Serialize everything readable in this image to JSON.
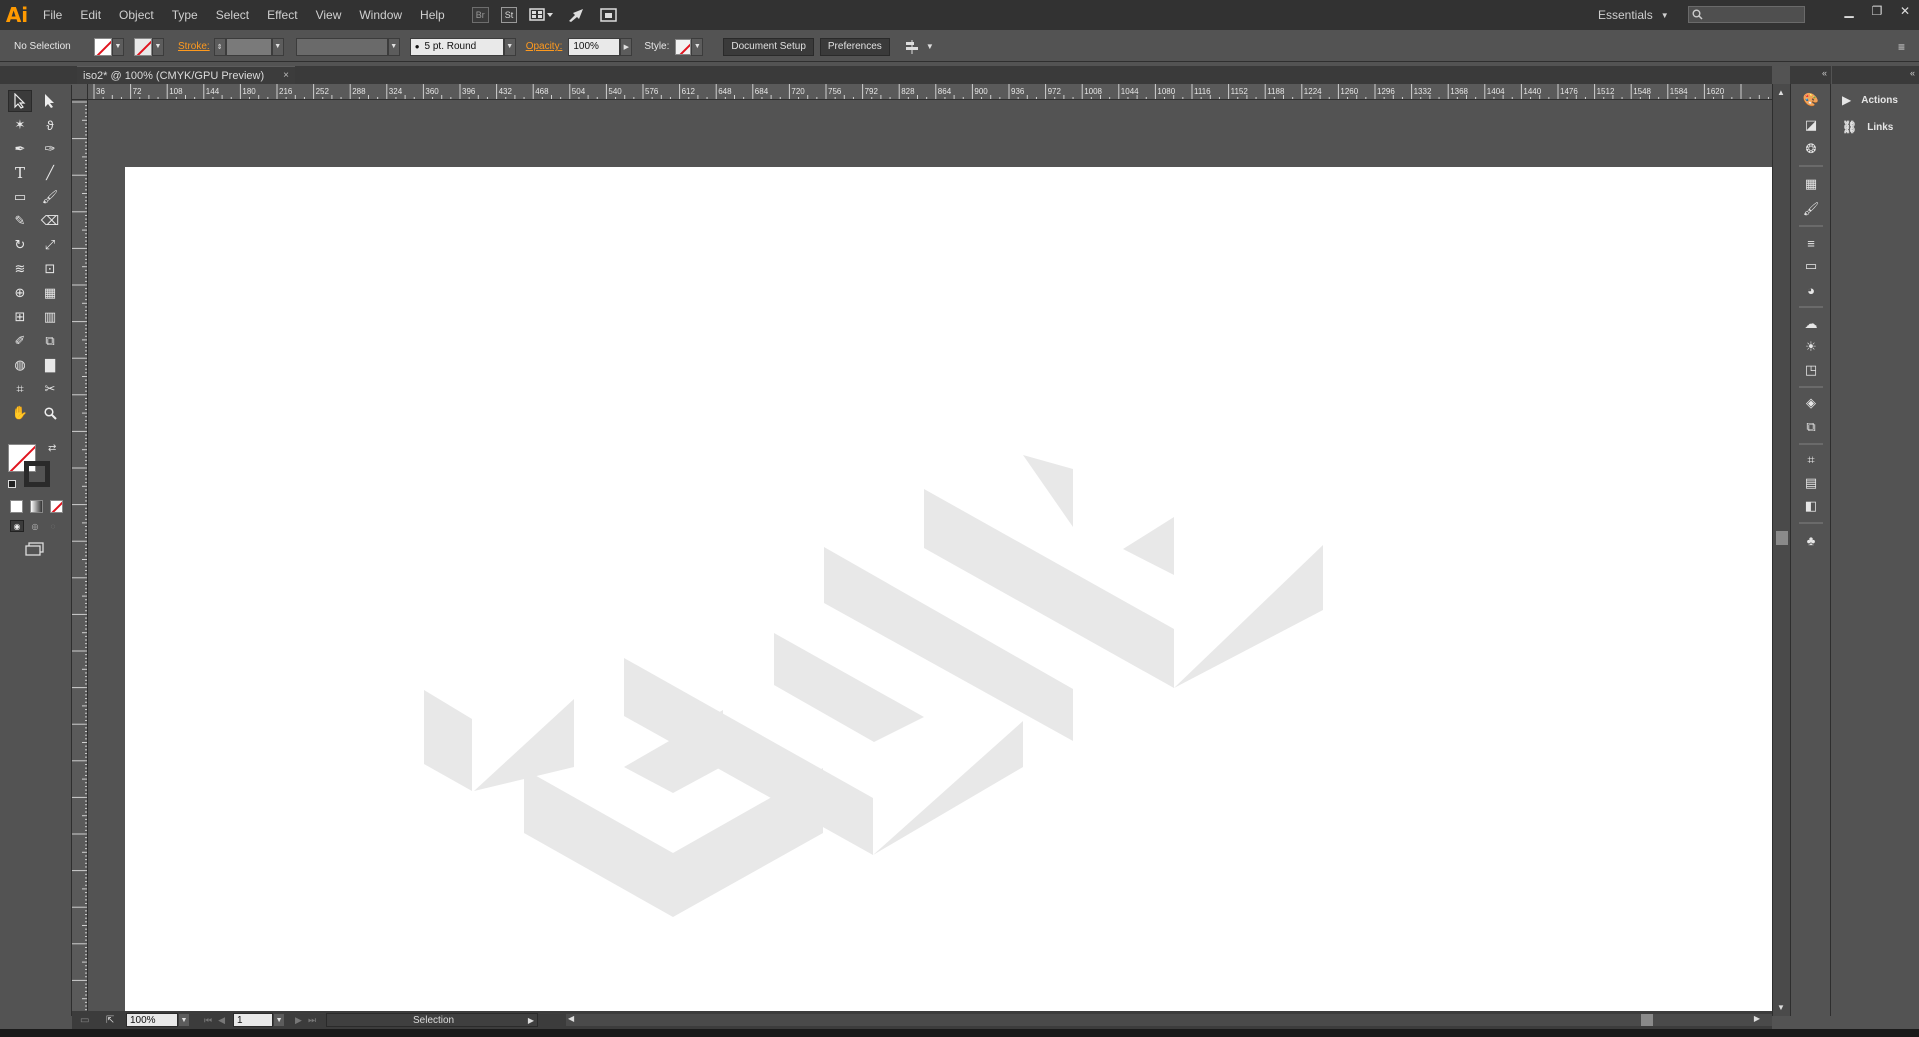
{
  "menubar": {
    "logo": "Ai",
    "items": [
      "File",
      "Edit",
      "Object",
      "Type",
      "Select",
      "Effect",
      "View",
      "Window",
      "Help"
    ],
    "bridge_label": "Br",
    "stock_label": "St",
    "workspace": "Essentials"
  },
  "control": {
    "selection": "No Selection",
    "stroke_label": "Stroke:",
    "brush": "5 pt. Round",
    "opacity_label": "Opacity:",
    "opacity": "100%",
    "style_label": "Style:",
    "doc_setup": "Document Setup",
    "preferences": "Preferences"
  },
  "tab": {
    "title": "iso2* @ 100% (CMYK/GPU Preview)",
    "close": "×"
  },
  "ruler": {
    "labels": [
      "36",
      "72",
      "108",
      "144",
      "180",
      "216",
      "252",
      "288",
      "324",
      "360",
      "396",
      "432",
      "468",
      "504",
      "540",
      "576",
      "612",
      "648",
      "684",
      "720",
      "756",
      "792",
      "828",
      "864",
      "900",
      "936",
      "972",
      "1008",
      "1044",
      "1080",
      "1116",
      "1152",
      "1188",
      "1224",
      "1260",
      "1296",
      "1332",
      "1368",
      "1404",
      "1440",
      "1476",
      "1512",
      "1548",
      "1584",
      "1620"
    ]
  },
  "panel": {
    "actions": "Actions",
    "links": "Links"
  },
  "status": {
    "zoom": "100%",
    "artboard": "1",
    "tool": "Selection"
  },
  "colors": {
    "accent": "#ff9a00",
    "artwork": "#e8e8e8"
  }
}
